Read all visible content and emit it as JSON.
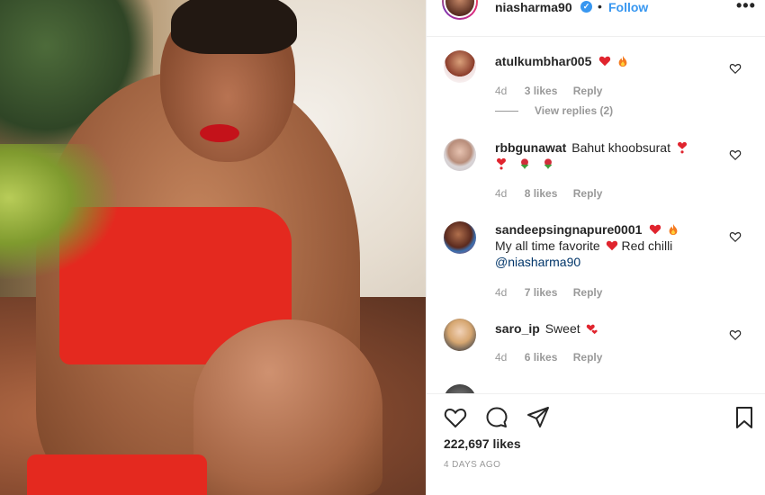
{
  "header": {
    "username": "niasharma90",
    "verified_badge": "✓",
    "separator": "•",
    "follow_label": "Follow",
    "more_label": "•••"
  },
  "comments": [
    {
      "username": "atulkumbhar005",
      "text": "",
      "emojis": [
        "heart",
        "fire"
      ],
      "time": "4d",
      "likes": "3 likes",
      "reply_label": "Reply",
      "view_replies": "View replies (2)"
    },
    {
      "username": "rbbgunawat",
      "text": "Bahut khoobsurat",
      "emojis": [
        "heart-exclamation",
        "heart-exclamation",
        "rose",
        "rose"
      ],
      "time": "4d",
      "likes": "8 likes",
      "reply_label": "Reply"
    },
    {
      "username": "sandeepsingnapure0001",
      "line2_a": "My all time favorite",
      "line2_b": "Red chilli",
      "mention": "@niasharma90",
      "emojis": [
        "heart",
        "fire",
        "heart"
      ],
      "time": "4d",
      "likes": "7 likes",
      "reply_label": "Reply"
    },
    {
      "username": "saro_ip",
      "text": "Sweet",
      "emojis": [
        "two-hearts"
      ],
      "time": "4d",
      "likes": "6 likes",
      "reply_label": "Reply"
    }
  ],
  "footer": {
    "likes": "222,697 likes",
    "posted": "4 DAYS AGO"
  },
  "colors": {
    "accent": "#3897f0",
    "text": "#262626",
    "muted": "#999999",
    "bikini_red": "#e4291f"
  },
  "icons": [
    "verified-icon",
    "more-options-icon",
    "comment-heart-icon",
    "like-icon",
    "comment-icon",
    "share-icon",
    "save-icon"
  ]
}
